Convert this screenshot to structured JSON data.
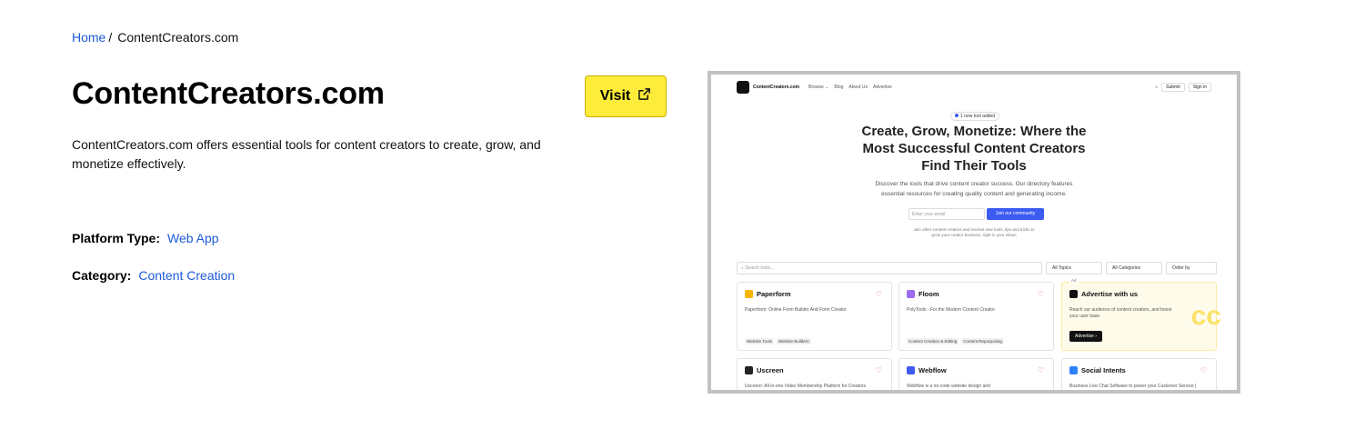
{
  "breadcrumb": {
    "home": "Home",
    "separator": "/",
    "current": "ContentCreators.com"
  },
  "title": "ContentCreators.com",
  "description": "ContentCreators.com offers essential tools for content creators to create, grow, and monetize effectively.",
  "visit_button": {
    "label": "Visit",
    "icon": "external-link-icon",
    "color": "#fdec3a"
  },
  "platform_type": {
    "label": "Platform Type:",
    "value": "Web App"
  },
  "category": {
    "label": "Category:",
    "value": "Content Creation"
  },
  "screenshot": {
    "nav": {
      "brand": "ContentCreators.com",
      "links": [
        "Browse ⌄",
        "Blog",
        "About Us",
        "Advertise"
      ],
      "submit": "Submit",
      "signin": "Sign in"
    },
    "pill": "1 new tool added",
    "hero": [
      "Create, Grow, Monetize: Where the",
      "Most Successful Content Creators",
      "Find Their Tools"
    ],
    "subtitle": [
      "Discover the tools that drive content creator success. Our directory features",
      "essential resources for creating quality content and generating income."
    ],
    "email_placeholder": "Enter your email",
    "join_button": "Join our community",
    "note": [
      "Join other content creators and receive new tools, tips and tricks to",
      "grow your creator business, right in your inbox!"
    ],
    "search_placeholder": "Search tools...",
    "filters": [
      "All Topics",
      "All Categories",
      "Order by"
    ],
    "cards": [
      {
        "title": "Paperform",
        "desc": "Paperform: Online Form Builder And Form Creator",
        "tags": [
          "Website Tools",
          "Website Builders"
        ],
        "icon_color": "#f5b400"
      },
      {
        "title": "Floom",
        "desc": "PolyTools - For the Modern Content Creator",
        "tags": [
          "Content Creation & Editing",
          "Content Repurposing"
        ],
        "icon_color": "#9b6cf0"
      },
      {
        "title": "Advertise with us",
        "desc": "Reach our audience of content creators, and boost your user base.",
        "button": "Advertise ›",
        "ad_label": "Ad"
      },
      {
        "title": "Uscreen",
        "desc": "Uscreen: All-in-one Video Membership Platform for Creators",
        "icon_color": "#222222"
      },
      {
        "title": "Webflow",
        "desc": "Webflow is a no-code website design and",
        "icon_color": "#3c5bf0"
      },
      {
        "title": "Social Intents",
        "desc": "Business Live Chat Software to power your Customer Service |",
        "icon_color": "#2d7ff9"
      }
    ]
  }
}
